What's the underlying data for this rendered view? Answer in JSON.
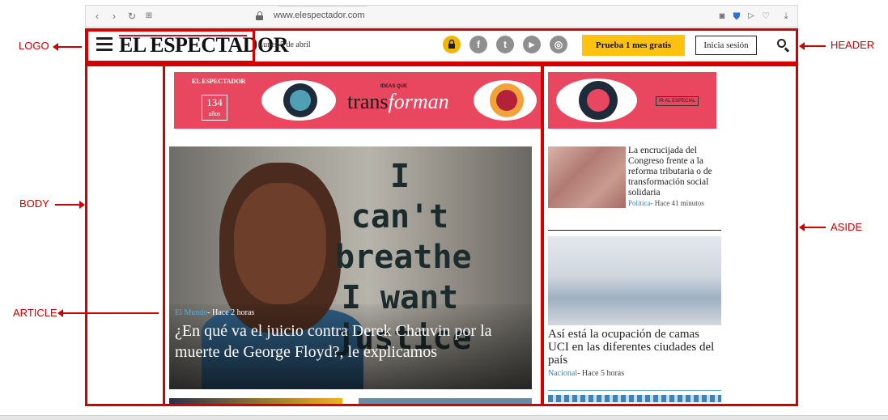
{
  "browser": {
    "url": "www.elespectador.com",
    "icons": [
      "back-icon",
      "forward-icon",
      "reload-icon",
      "grid-icon",
      "camera-icon",
      "shield-icon",
      "send-icon",
      "heart-icon",
      "download-icon"
    ]
  },
  "header": {
    "logo": "EL ESPECTADOR",
    "date": "Lunes 5 de abril",
    "social": [
      "f",
      "t",
      "▶",
      "◎"
    ],
    "subscribe_label": "Prueba 1 mes gratis",
    "login_label": "Inicia sesión",
    "cta_color": "#ffc20e"
  },
  "banner": {
    "small_logo": "EL ESPECTADOR",
    "years_num": "134",
    "years_word": "años",
    "ideas": "IDEAS QUE",
    "word_dark": "trans",
    "word_light": "forman",
    "special": "IR AL ESPECIAL"
  },
  "hero": {
    "graffiti": "I can't breathe I want justice",
    "section": "El Mundo",
    "time": "- Hace 2 horas",
    "title": "¿En qué va el juicio contra Derek Chauvin por la muerte de George Floyd?, le explicamos"
  },
  "aside": {
    "items": [
      {
        "title": "La encrucijada del Congreso frente a la reforma tributaria o de transformación social solidaria",
        "section": "Política",
        "time": "- Hace 41 minutos"
      },
      {
        "title": "Así está la ocupación de camas UCI en las diferentes ciudades del país",
        "section": "Nacional",
        "time": "- Hace 5 horas"
      }
    ]
  },
  "annotations": {
    "logo": "LOGO",
    "header": "HEADER",
    "body": "BODY",
    "article": "ARTICLE",
    "aside": "ASIDE",
    "color": "#cc0000"
  }
}
